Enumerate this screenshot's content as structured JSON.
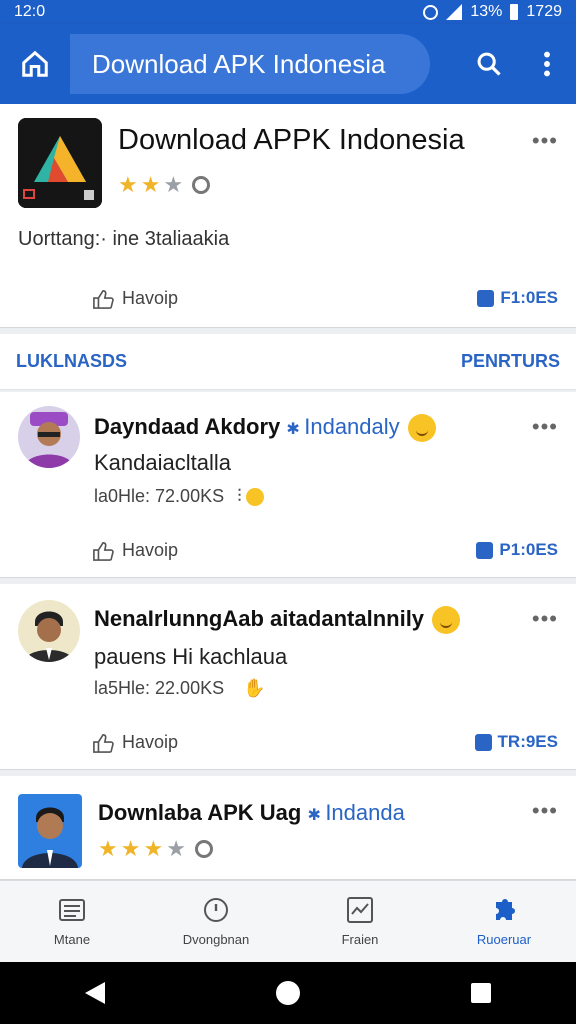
{
  "status_bar": {
    "time": "12:0",
    "battery": "13%",
    "clock_right": "1729"
  },
  "app_bar": {
    "title": "Download APK Indonesia"
  },
  "app_card": {
    "title": "Download APPK Indonesia",
    "rating_stars": 2,
    "description": "Uorttang:· ine 3taliaakia",
    "like_label": "Havoip",
    "share_label": "F1:0ES"
  },
  "section": {
    "left_label": "LUKLNASDS",
    "right_label": "PENRTURS"
  },
  "posts": [
    {
      "name": "Dayndaad Akdory",
      "tag": "Indandaly",
      "subtitle": "Kandaiacltalla",
      "meta": "la0Hle: 72.00KS",
      "like_label": "Havoip",
      "share_label": "P1:0ES"
    },
    {
      "name": "NenaIrlunngAab aitadantalnnily",
      "tag": "",
      "subtitle": "pauens Hi kachlaua",
      "meta": "la5Hle: 22.00KS",
      "like_label": "Havoip",
      "share_label": "TR:9ES"
    },
    {
      "name": "Downlaba APK Uag",
      "tag": "Indanda",
      "subtitle": "",
      "meta": "",
      "rating_stars": 3,
      "like_label": "",
      "share_label": ""
    }
  ],
  "bottom_nav": [
    {
      "label": "Mtane",
      "icon": "list-icon",
      "active": false
    },
    {
      "label": "Dvongbnan",
      "icon": "clock-icon",
      "active": false
    },
    {
      "label": "Fraien",
      "icon": "chart-icon",
      "active": false
    },
    {
      "label": "Ruoeruar",
      "icon": "puzzle-icon",
      "active": true
    }
  ],
  "colors": {
    "primary": "#1d5fc9",
    "accent": "#2a64c4",
    "star": "#f0b429"
  }
}
